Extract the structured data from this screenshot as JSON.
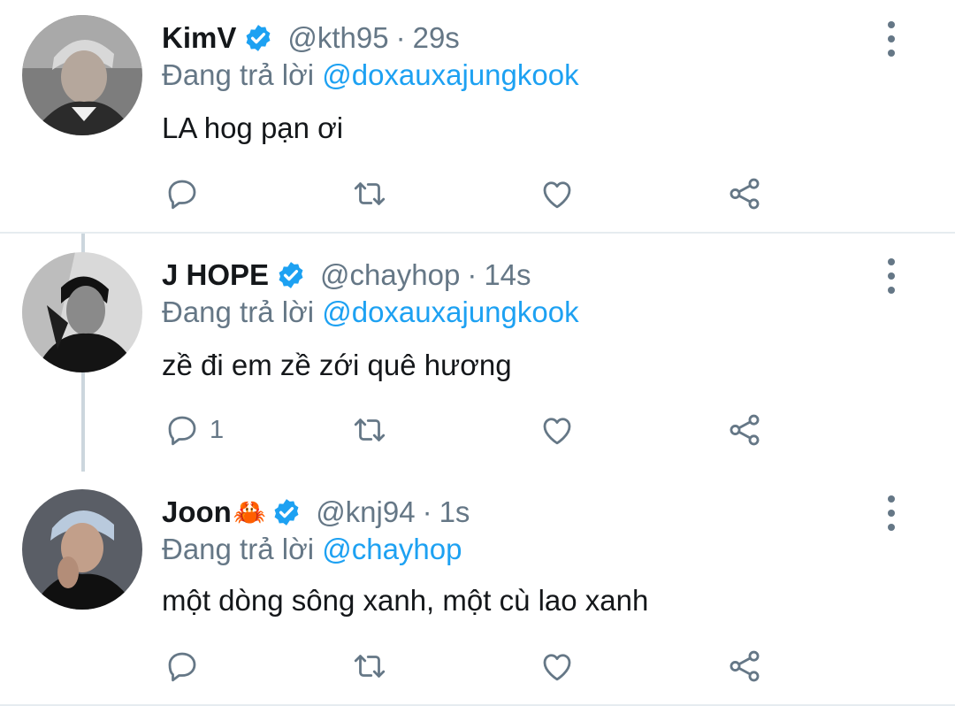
{
  "tweets": [
    {
      "name": "KimV",
      "name_emoji": "",
      "handle": "@kth95",
      "separator": "·",
      "time": "29s",
      "reply_prefix": "Đang trả lời",
      "reply_mention": "@doxauxajungkook",
      "text": "LA hog pạn ơi",
      "reply_count": "",
      "avatar_icon": "avatar-kimv",
      "verified_icon": "verified-badge-icon"
    },
    {
      "name": "J HOPE",
      "name_emoji": "",
      "handle": "@chayhop",
      "separator": "·",
      "time": "14s",
      "reply_prefix": "Đang trả lời",
      "reply_mention": "@doxauxajungkook",
      "text": "zề đi em zề zới quê hương",
      "reply_count": "1",
      "avatar_icon": "avatar-jhope",
      "verified_icon": "verified-badge-icon"
    },
    {
      "name": "Joon",
      "name_emoji": "🦀",
      "handle": "@knj94",
      "separator": "·",
      "time": "1s",
      "reply_prefix": "Đang trả lời",
      "reply_mention": "@chayhop",
      "text": "một dòng sông xanh, một cù lao xanh",
      "reply_count": "",
      "avatar_icon": "avatar-joon",
      "verified_icon": "verified-badge-icon"
    }
  ],
  "colors": {
    "accent": "#1da1f2",
    "secondary_text": "#657786",
    "primary_text": "#14171a",
    "divider": "#e6ecf0",
    "thread_line": "#ccd6dd"
  },
  "icons": {
    "reply": "reply-icon",
    "retweet": "retweet-icon",
    "like": "like-icon",
    "share": "share-icon",
    "more": "more-options-icon"
  }
}
